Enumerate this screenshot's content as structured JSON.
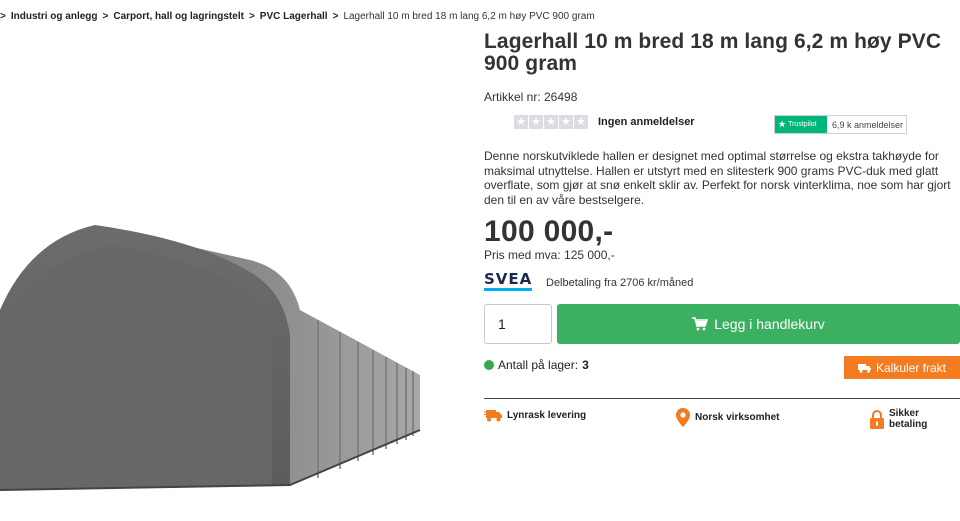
{
  "breadcrumb": {
    "items": [
      "Industri og anlegg",
      "Carport, hall og lagringstelt",
      "PVC Lagerhall"
    ],
    "current": "Lagerhall 10 m bred 18 m lang 6,2 m høy PVC 900 gram",
    "separator": ">"
  },
  "product": {
    "title": "Lagerhall 10 m bred 18 m lang 6,2 m høy PVC 900 gram",
    "article_no": "Artikkel nr: 26498",
    "rating": 0,
    "reviews_label": "Ingen anmeldelser",
    "description": "Denne norskutviklede hallen er designet med optimal størrelse og ekstra takhøyde for maksimal utnyttelse. Hallen er utstyrt med en slitesterk 900 grams PVC-duk med glatt overflate, som gjør at snø enkelt sklir av. Perfekt for norsk vinterklima, noe som har gjort den til en av våre bestselgere.",
    "price": "100 000,-",
    "price_vat": "Pris med mva: 125 000,-"
  },
  "trustpilot": {
    "logo_text": "Trustpilot",
    "reviews": "6,9 k anmeldelser"
  },
  "financing": {
    "logo_text": "SVEA",
    "installment": "Delbetaling fra 2706 kr/måned"
  },
  "cart": {
    "quantity": "1",
    "add_label": "Legg i handlekurv"
  },
  "stock": {
    "label": "Antall på lager:",
    "count": "3"
  },
  "freight": {
    "label": "Kalkuler frakt"
  },
  "usps": [
    {
      "label": "Lynrask levering",
      "icon": "truck-icon"
    },
    {
      "label": "Norsk virksomhet",
      "icon": "location-pin-icon"
    },
    {
      "label": "Sikker betaling",
      "icon": "lock-icon"
    }
  ],
  "colors": {
    "green": "#3cb061",
    "orange": "#f37b20",
    "trustpilot": "#00b67a",
    "stock_dot": "#37a84f"
  }
}
